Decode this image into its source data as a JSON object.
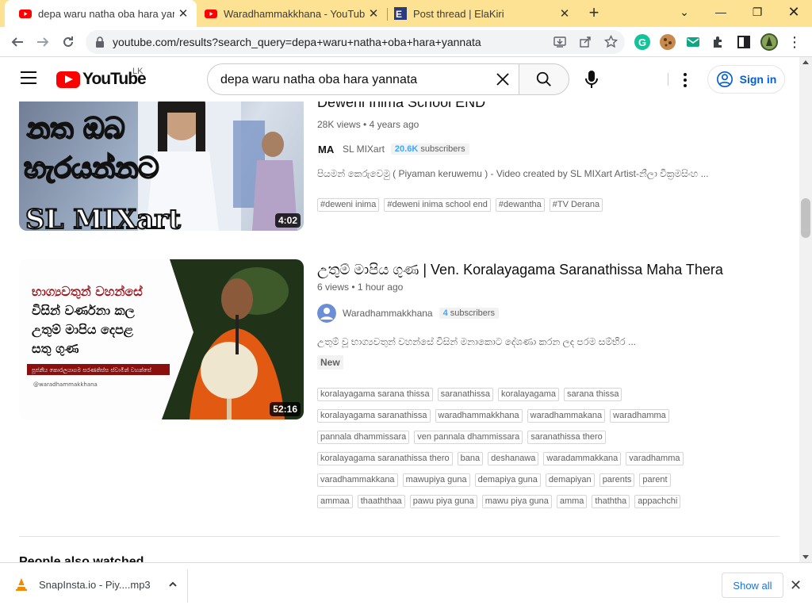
{
  "browser": {
    "tabs": [
      {
        "title": "depa waru natha oba hara yanna",
        "icon": "youtube-favicon",
        "active": true
      },
      {
        "title": "Waradhammakkhana - YouTube",
        "icon": "youtube-favicon",
        "active": false
      },
      {
        "title": "Post thread | ElaKiri",
        "icon": "elakiri-favicon",
        "active": false
      }
    ],
    "url": "youtube.com/results?search_query=depa+waru+natha+oba+hara+yannata"
  },
  "youtube": {
    "logo_text": "YouTube",
    "country_code": "LK",
    "search_query": "depa waru natha oba hara yannata",
    "signin_label": "Sign in"
  },
  "results": [
    {
      "title": "Deweni Inima School END",
      "views": "28K views",
      "age": "4 years ago",
      "channel": "SL MIXart",
      "subs_count": "20.6K",
      "subs_word": "subscribers",
      "description": "පියමන් කෙරුවෙමු ( Piyaman keruwemu ) - Video created by SL MIXart Artist-නීලා වික්‍රමසිංහ ...",
      "duration": "4:02",
      "thumb_text": [
        "නත ඔබ",
        "හැරයන්නට",
        "SL MIXart"
      ],
      "tags": [
        "#deweni inima",
        "#deweni inima school end",
        "#dewantha",
        "#TV Derana"
      ]
    },
    {
      "title": "උතුම් මාපිය ගුණ | Ven. Koralayagama Saranathissa Maha Thera",
      "views": "6 views",
      "age": "1 hour ago",
      "channel": "Waradhammakkhana",
      "subs_count": "4",
      "subs_word": "subscribers",
      "description": "උතුම් වූ භාග්‍යවතුන් වහන්සේ විසින් මනාකොට දේශණා කරන ලද පරම සම්භීර ...",
      "badge": "New",
      "duration": "52:16",
      "thumb_text": [
        "භාග්‍යවතුන් වහන්සේ",
        "විසින් වර්ණනා කල",
        "උතුම් මාපිය දෙපළ",
        "සතු ගුණ",
        "පූජනීය කොරලයාගම සරණතිස්ස ස්වාමීන් වහන්සේ",
        "@waradhammakkhana"
      ],
      "tags": [
        "koralayagama sarana thissa",
        "saranathissa",
        "koralayagama",
        "sarana thissa",
        "koralayagama saranathissa",
        "waradhammakkhana",
        "waradhammakana",
        "waradhamma",
        "pannala dhammissara",
        "ven pannala dhammissara",
        "saranathissa thero",
        "koralayagama saranathissa thero",
        "bana",
        "deshanawa",
        "waradammakkana",
        "varadhamma",
        "varadhammakkana",
        "mawupiya guna",
        "demapiya guna",
        "demapiyan",
        "parents",
        "parent",
        "ammaa",
        "thaaththaa",
        "pawu piya guna",
        "mawu piya guna",
        "amma",
        "thaththa",
        "appachchi"
      ]
    }
  ],
  "section_heading": "People also watched",
  "download_bar": {
    "file_name": "SnapInsta.io - Piy....mp3",
    "show_all": "Show all"
  },
  "colors": {
    "brand_red": "#ff0000",
    "tab_bar": "#fde293",
    "link_blue": "#065fd4"
  }
}
